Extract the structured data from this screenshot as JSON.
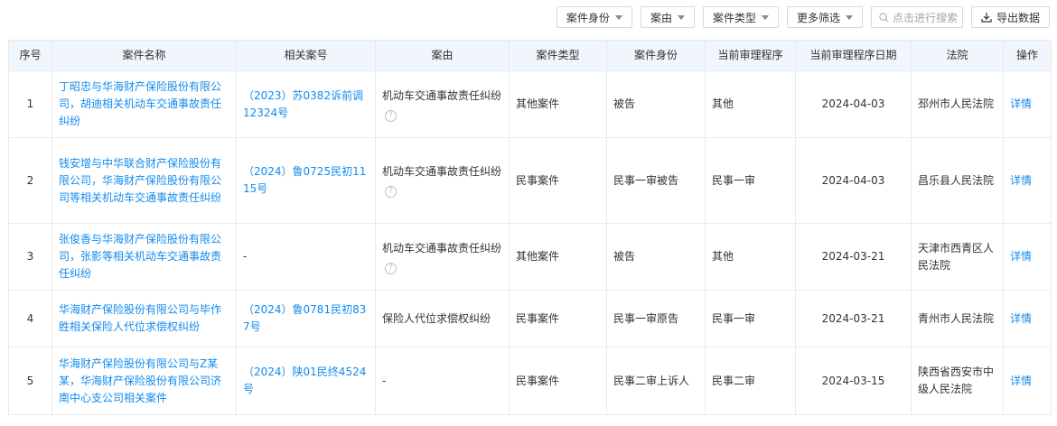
{
  "toolbar": {
    "filter_identity": "案件身份",
    "filter_cause": "案由",
    "filter_type": "案件类型",
    "filter_more": "更多筛选",
    "search_placeholder": "点击进行搜索",
    "export_label": "导出数据"
  },
  "table": {
    "headers": [
      "序号",
      "案件名称",
      "相关案号",
      "案由",
      "案件类型",
      "案件身份",
      "当前审理程序",
      "当前审理程序日期",
      "法院",
      "操作"
    ],
    "detail_label": "详情",
    "rows": [
      {
        "idx": "1",
        "name": "丁昭忠与华海财产保险股份有限公司，胡迪相关机动车交通事故责任纠纷",
        "case_no": "（2023）苏0382诉前调12324号",
        "cause": "机动车交通事故责任纠纷",
        "cause_help": true,
        "type": "其他案件",
        "identity": "被告",
        "procedure": "其他",
        "date": "2024-04-03",
        "court": "邳州市人民法院"
      },
      {
        "idx": "2",
        "name": "钱安增与中华联合财产保险股份有限公司，华海财产保险股份有限公司等相关机动车交通事故责任纠纷",
        "case_no": "（2024）鲁0725民初1115号",
        "cause": "机动车交通事故责任纠纷",
        "cause_help": true,
        "type": "民事案件",
        "identity": "民事一审被告",
        "procedure": "民事一审",
        "date": "2024-04-03",
        "court": "昌乐县人民法院"
      },
      {
        "idx": "3",
        "name": "张俊香与华海财产保险股份有限公司，张影等相关机动车交通事故责任纠纷",
        "case_no": "-",
        "cause": "机动车交通事故责任纠纷",
        "cause_help": true,
        "type": "其他案件",
        "identity": "被告",
        "procedure": "其他",
        "date": "2024-03-21",
        "court": "天津市西青区人民法院"
      },
      {
        "idx": "4",
        "name": "华海财产保险股份有限公司与毕作胜相关保险人代位求偿权纠纷",
        "case_no": "（2024）鲁0781民初837号",
        "cause": "保险人代位求偿权纠纷",
        "cause_help": false,
        "type": "民事案件",
        "identity": "民事一审原告",
        "procedure": "民事一审",
        "date": "2024-03-21",
        "court": "青州市人民法院"
      },
      {
        "idx": "5",
        "name": "华海财产保险股份有限公司与Z某某，华海财产保险股份有限公司济南中心支公司相关案件",
        "case_no": "（2024）陕01民终4524号",
        "cause": "-",
        "cause_help": false,
        "type": "民事案件",
        "identity": "民事二审上诉人",
        "procedure": "民事二审",
        "date": "2024-03-15",
        "court": "陕西省西安市中级人民法院"
      }
    ]
  }
}
